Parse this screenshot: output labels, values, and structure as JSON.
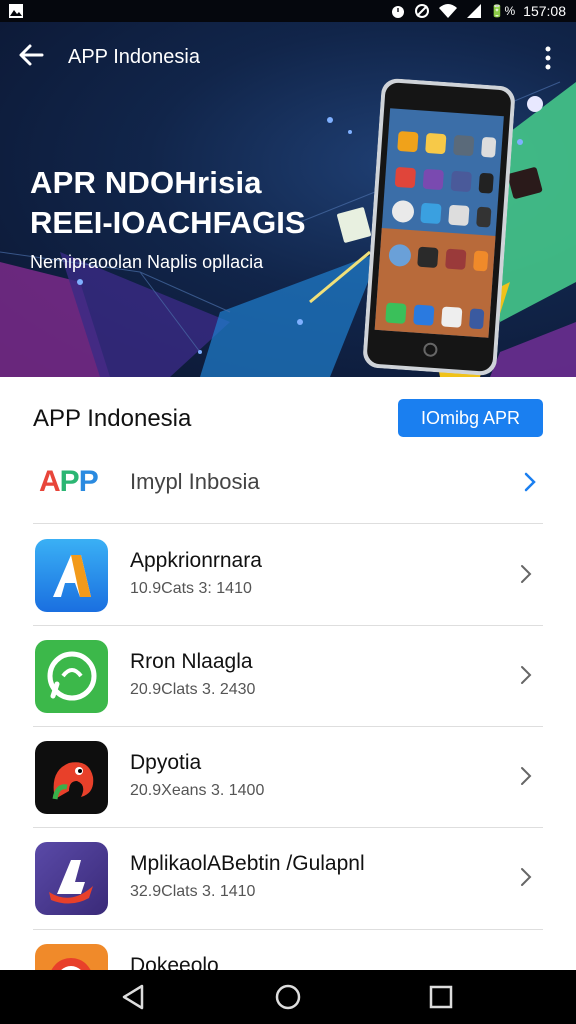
{
  "status_bar": {
    "battery": "🔋%",
    "time": "157:08"
  },
  "app_bar": {
    "title": "APP Indonesia"
  },
  "hero": {
    "headline_1": "APR NDOHrisia",
    "headline_2": "REEI-IOACHFAGIS",
    "subtitle": "Nemipraoolan Naplis opllacia"
  },
  "section": {
    "title": "APP Indonesia",
    "cta_label": "IOmibg APR"
  },
  "featured": {
    "logo": "APP",
    "label": "Imypl Inbosia"
  },
  "apps": [
    {
      "name": "Appkrionrnara",
      "meta": "10.9Cats 3: 1410",
      "icon": "a-logo-icon"
    },
    {
      "name": "Rron Nlaagla",
      "meta": "20.9Clats 3. 2430",
      "icon": "chat-bubble-icon"
    },
    {
      "name": "Dpyotia",
      "meta": "20.9Xeans 3. 1400",
      "icon": "red-creature-icon"
    },
    {
      "name": "MplikaolABebtin /Gulapnl",
      "meta": "32.9Clats 3. 1410",
      "icon": "a-shield-icon"
    },
    {
      "name": "Dokeeolo",
      "meta": "",
      "icon": "orange-circle-icon"
    }
  ],
  "colors": {
    "accent": "#1a7ff0",
    "hero_bg": "#11254a"
  }
}
